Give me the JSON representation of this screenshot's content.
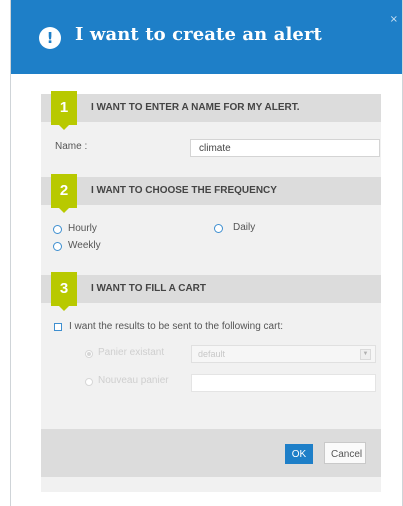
{
  "dialog": {
    "title": "I want to create an alert",
    "close_label": "×",
    "header_icon": "exclamation-icon",
    "colors": {
      "header": "#1e7fc8",
      "step_badge": "#b8c900",
      "section_bar": "#dcdcdc"
    }
  },
  "section1": {
    "number": "1",
    "title": "I WANT TO ENTER A NAME FOR MY ALERT.",
    "name_label": "Name :",
    "name_value": "climate"
  },
  "section2": {
    "number": "2",
    "title": "I WANT TO CHOOSE THE FREQUENCY",
    "options": {
      "hourly": "Hourly",
      "daily": "Daily",
      "weekly": "Weekly"
    }
  },
  "section3": {
    "number": "3",
    "title": "I WANT TO FILL A CART",
    "checkbox_label": "I want the results to be sent to the following cart:",
    "existing_cart_label": "Panier existant",
    "existing_cart_value": "default",
    "new_cart_label": "Nouveau panier"
  },
  "footer": {
    "ok_label": "OK",
    "cancel_label": "Cancel"
  }
}
